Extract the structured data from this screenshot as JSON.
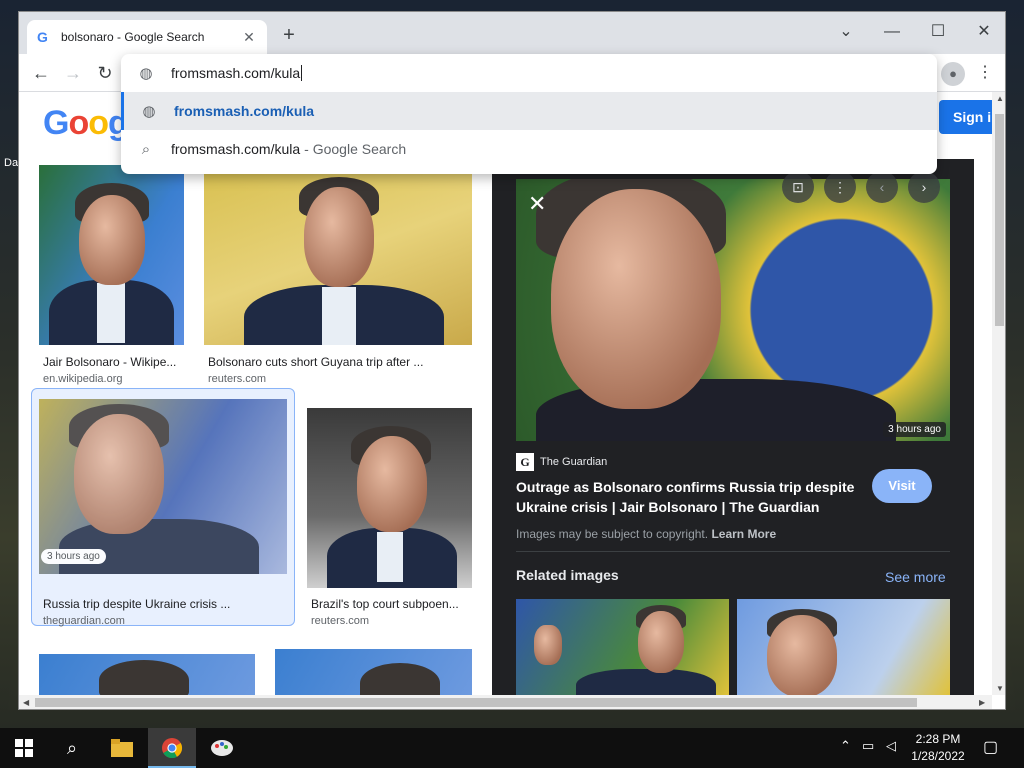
{
  "browser": {
    "tab_title": "bolsonaro - Google Search",
    "tab_favicon": "G",
    "new_tab_label": "+",
    "minimize_label": "—",
    "maximize_label": "☐",
    "close_label": "✕",
    "tabsearch_label": "⌄",
    "back_label": "←",
    "forward_label": "→",
    "reload_label": "↻",
    "menu_label": "⋮"
  },
  "omnibox": {
    "input_value": "fromsmash.com/kula",
    "suggestion_url": "fromsmash.com/kula",
    "suggestion_search_query": "fromsmash.com/kula",
    "suggestion_search_suffix": "- Google Search"
  },
  "page": {
    "logo_text": "Googl",
    "signin_label": "Sign i",
    "results": [
      {
        "caption": "Jair Bolsonaro - Wikipe...",
        "source": "en.wikipedia.org"
      },
      {
        "caption": "Bolsonaro cuts short Guyana trip after ...",
        "source": "reuters.com"
      },
      {
        "caption": "Russia trip despite Ukraine crisis ...",
        "source": "theguardian.com",
        "badge": "3 hours ago"
      },
      {
        "caption": "Brazil's top court subpoen...",
        "source": "reuters.com"
      }
    ]
  },
  "preview": {
    "time_badge": "3 hours ago",
    "source_name": "The Guardian",
    "source_logo": "G",
    "title": "Outrage as Bolsonaro confirms Russia trip despite Ukraine crisis | Jair Bolsonaro | The Guardian",
    "visit_label": "Visit",
    "copyright_text": "Images may be subject to copyright.",
    "learn_more": "Learn More",
    "related_heading": "Related images",
    "see_more": "See more"
  },
  "desktop": {
    "fragment": "Da"
  },
  "taskbar": {
    "time": "2:28 PM",
    "date": "1/28/2022"
  },
  "colors": {
    "accent_blue": "#1a73e8",
    "panel_bg": "#202124",
    "visit_blue": "#8ab4f8"
  }
}
